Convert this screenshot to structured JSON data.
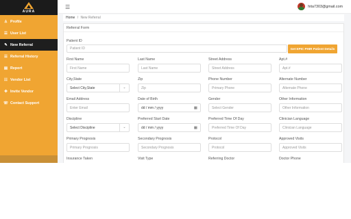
{
  "brand": {
    "name": "AURA"
  },
  "sidebar": {
    "items": [
      {
        "label": "Profile",
        "icon": "person-icon",
        "glyph": "♙"
      },
      {
        "label": "User List",
        "icon": "users-icon",
        "glyph": "☰"
      },
      {
        "label": "New Referral",
        "icon": "pencil-icon",
        "glyph": "✎"
      },
      {
        "label": "Referral History",
        "icon": "history-icon",
        "glyph": "☰"
      },
      {
        "label": "Report",
        "icon": "report-icon",
        "glyph": "▤"
      },
      {
        "label": "Vendor List",
        "icon": "vendor-icon",
        "glyph": "☷"
      },
      {
        "label": "Invite Vendor",
        "icon": "invite-icon",
        "glyph": "✚"
      },
      {
        "label": "Contact Support",
        "icon": "support-icon",
        "glyph": "☏"
      }
    ]
  },
  "topbar": {
    "user_email": "hita7303@gmail.com"
  },
  "breadcrumb": {
    "home": "Home",
    "separator": "/",
    "current": "New Referral"
  },
  "form": {
    "title": "Referral Form",
    "patient_id": {
      "label": "Patient ID",
      "placeholder": "Patient ID"
    },
    "get_button": "Get EPIC PHIR Patient Details",
    "rows": [
      [
        {
          "label": "First Name",
          "value": "First Name"
        },
        {
          "label": "Last Name",
          "value": "Last Name"
        },
        {
          "label": "Street Address",
          "value": "Street Address"
        },
        {
          "label": "Apt.#",
          "value": "Apt.#"
        }
      ],
      [
        {
          "label": "City,State",
          "value": "Select City,State",
          "kind": "select"
        },
        {
          "label": "Zip",
          "value": "Zip"
        },
        {
          "label": "Phone Number",
          "value": "Primary Phone"
        },
        {
          "label": "Alternate Number",
          "value": "Alternate Phone"
        }
      ],
      [
        {
          "label": "Email Address",
          "value": "Enter Email"
        },
        {
          "label": "Date of Birth",
          "value": "dd / mm / yyyy",
          "kind": "date"
        },
        {
          "label": "Gender",
          "value": "Select Gender"
        },
        {
          "label": "Other Information",
          "value": "Other Information"
        }
      ],
      [
        {
          "label": "Discipline",
          "value": "Select Discipline",
          "kind": "select"
        },
        {
          "label": "Preferred Start Date",
          "value": "dd / mm / yyyy",
          "kind": "date"
        },
        {
          "label": "Preferred Time Of Day",
          "value": "Preferred Time Of Day"
        },
        {
          "label": "Clinician Language",
          "value": "Clinician Language"
        }
      ],
      [
        {
          "label": "Primary Prognosis",
          "value": "Primary Prognosis"
        },
        {
          "label": "Secondary Prognosis",
          "value": "Secondary Prognosis"
        },
        {
          "label": "Protocol",
          "value": "Protocol"
        },
        {
          "label": "Approved Visits",
          "value": "Approved Visits"
        }
      ],
      [
        {
          "label": "Insurance Taken",
          "value": ""
        },
        {
          "label": "Visit Type",
          "value": ""
        },
        {
          "label": "Referring Doctor",
          "value": ""
        },
        {
          "label": "Doctor Phone",
          "value": ""
        }
      ]
    ]
  }
}
